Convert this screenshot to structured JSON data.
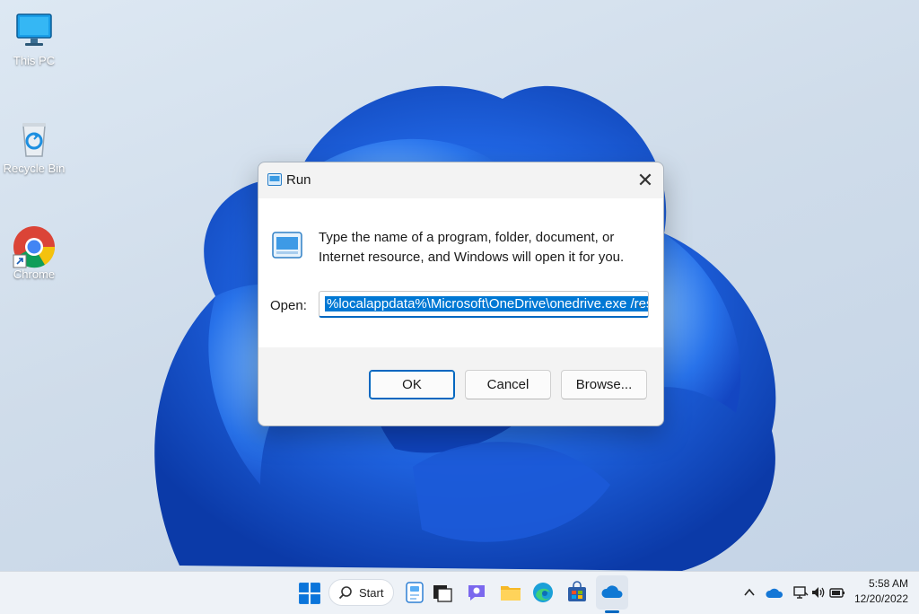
{
  "desktop": {
    "icons": [
      {
        "label": "This PC",
        "icon": "monitor-icon"
      },
      {
        "label": "Recycle Bin",
        "icon": "recycle-bin-icon"
      },
      {
        "label": "Chrome",
        "icon": "chrome-icon"
      }
    ]
  },
  "run_dialog": {
    "title": "Run",
    "description": "Type the name of a program, folder, document, or Internet resource, and Windows will open it for you.",
    "open_label": "Open:",
    "open_value": "%localappdata%\\Microsoft\\OneDrive\\onedrive.exe /reset",
    "close_symbol": "✕",
    "buttons": {
      "ok": "OK",
      "cancel": "Cancel",
      "browse": "Browse..."
    }
  },
  "taskbar": {
    "search_label": "Start",
    "pinned": [
      "windows-start-icon",
      "widgets-icon",
      "task-view-icon",
      "chat-icon",
      "file-explorer-icon",
      "edge-icon",
      "store-icon",
      "onedrive-icon"
    ],
    "tray": [
      "chevron-up-icon",
      "onedrive-cloud-icon",
      "display-icon",
      "volume-icon",
      "battery-icon"
    ],
    "time": "5:58 AM",
    "date": "12/20/2022"
  },
  "colors": {
    "accent": "#0067c0",
    "selection": "#0078d4",
    "wallpaper_blue": "#1e5fd6"
  }
}
